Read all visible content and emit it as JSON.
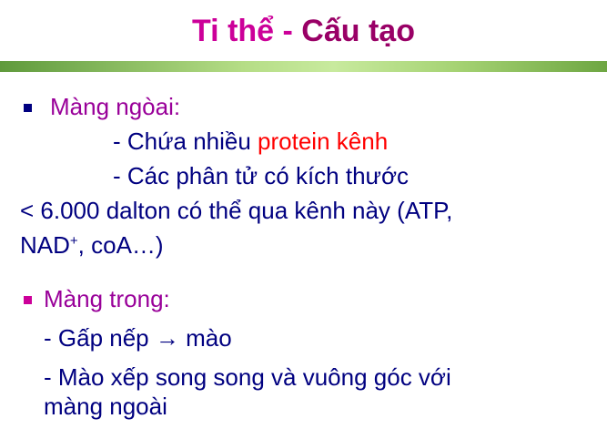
{
  "slide": {
    "title": {
      "part1": "Ti thể - ",
      "part2": "Cấu tạo"
    },
    "colors": {
      "title_primary": "#cc0099",
      "title_secondary": "#990066",
      "heading": "#990099",
      "body": "#000080",
      "highlight": "#ff0000",
      "divider_start": "#5f9a3c",
      "divider_mid": "#c8ea9e",
      "bullet_1": "#000080",
      "bullet_2": "#cc0099"
    },
    "outer_membrane": {
      "heading": "Màng ngòai:",
      "line1_prefix": "- Chứa nhiều ",
      "line1_highlight": "protein kênh",
      "line2": "- Các phân tử có kích thước",
      "line3": "< 6.000 dalton có thể qua kênh này (ATP,",
      "line4_pre": "NAD",
      "line4_sup": "+",
      "line4_post": ", coA…)"
    },
    "inner_membrane": {
      "heading": "Màng trong:",
      "line1": "- Gấp nếp → mào",
      "line2": "- Mào xếp song song và vuông góc với",
      "line3": "màng ngoài"
    }
  }
}
